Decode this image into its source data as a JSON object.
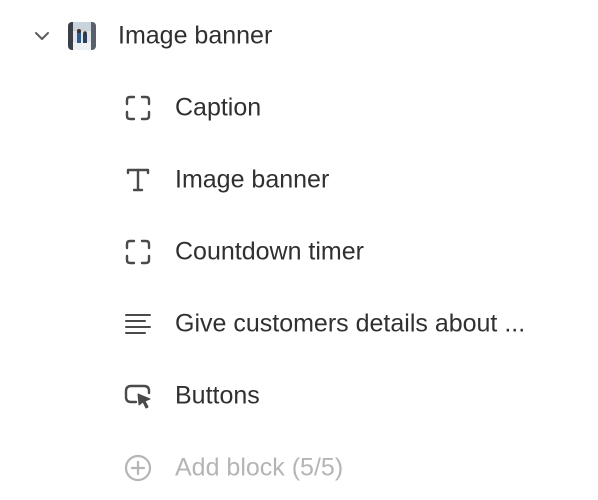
{
  "tree": {
    "parent": {
      "label": "Image banner",
      "expanded": true,
      "icon": "chevron-down-icon",
      "thumbnail": "image-thumbnail"
    },
    "children": [
      {
        "label": "Caption",
        "icon": "block-frame-icon"
      },
      {
        "label": "Image banner",
        "icon": "text-icon"
      },
      {
        "label": "Countdown timer",
        "icon": "block-frame-icon"
      },
      {
        "label": "Give customers details about ...",
        "icon": "paragraph-icon"
      },
      {
        "label": "Buttons",
        "icon": "button-cursor-icon"
      }
    ],
    "add_block": {
      "label": "Add block (5/5)",
      "icon": "plus-circle-icon",
      "disabled": true
    }
  },
  "colors": {
    "text": "#303030",
    "icon": "#4a4a4a",
    "disabled": "#b5b5b5"
  }
}
